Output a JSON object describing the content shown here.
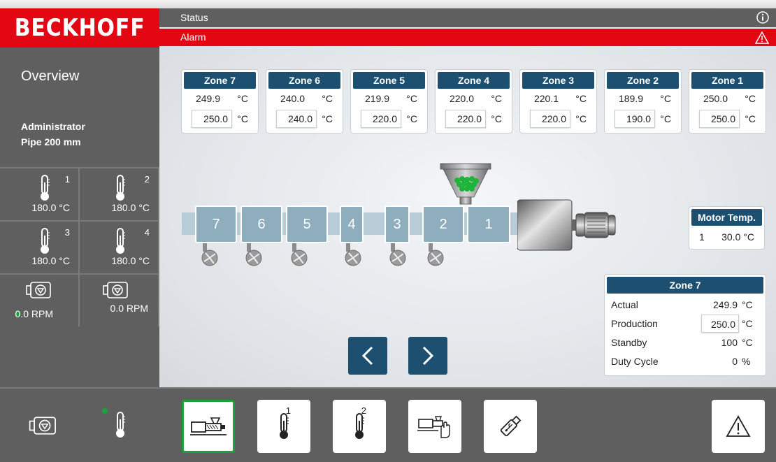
{
  "brand": "BECKHOFF",
  "status_label": "Status",
  "alarm_label": "Alarm",
  "page_title": "Overview",
  "user": {
    "role": "Administrator",
    "product": "Pipe 200 mm"
  },
  "sidebar_sensors": [
    {
      "id": "1",
      "value": "180.0 °C"
    },
    {
      "id": "2",
      "value": "180.0 °C"
    },
    {
      "id": "3",
      "value": "180.0 °C"
    },
    {
      "id": "4",
      "value": "180.0 °C"
    }
  ],
  "sidebar_motors": [
    {
      "value": "0.0 RPM",
      "running": true
    },
    {
      "value": "0.0 RPM",
      "running": false
    }
  ],
  "zones": [
    {
      "title": "Zone 7",
      "actual": "249.9",
      "setpoint": "250.0",
      "unit": "°C"
    },
    {
      "title": "Zone 6",
      "actual": "240.0",
      "setpoint": "240.0",
      "unit": "°C"
    },
    {
      "title": "Zone 5",
      "actual": "219.9",
      "setpoint": "220.0",
      "unit": "°C"
    },
    {
      "title": "Zone 4",
      "actual": "220.0",
      "setpoint": "220.0",
      "unit": "°C"
    },
    {
      "title": "Zone 3",
      "actual": "220.1",
      "setpoint": "220.0",
      "unit": "°C"
    },
    {
      "title": "Zone 2",
      "actual": "189.9",
      "setpoint": "190.0",
      "unit": "°C"
    },
    {
      "title": "Zone 1",
      "actual": "250.0",
      "setpoint": "250.0",
      "unit": "°C"
    }
  ],
  "barrel_segments": [
    "7",
    "6",
    "5",
    "4",
    "3",
    "2",
    "1"
  ],
  "motor_temp": {
    "title": "Motor Temp.",
    "index": "1",
    "value": "30.0 °C"
  },
  "zone_detail": {
    "title": "Zone 7",
    "rows": [
      {
        "label": "Actual",
        "value": "249.9",
        "unit": "°C"
      },
      {
        "label": "Production",
        "value": "250.0",
        "unit": "°C"
      },
      {
        "label": "Standby",
        "value": "100",
        "unit": "°C"
      },
      {
        "label": "Duty Cycle",
        "value": "0",
        "unit": "%"
      }
    ]
  },
  "toolbar": {
    "thermo1_sup": "1",
    "thermo2_sup": "2"
  },
  "colors": {
    "brand_red": "#e30613",
    "header_blue": "#1d5070",
    "panel_gray": "#5f5f5f",
    "status_green": "#1ea13c",
    "segment_blue": "#8eaebd"
  },
  "icons": [
    "info-icon",
    "warning-icon",
    "thermometer-icon",
    "motor-icon",
    "extruder-icon",
    "machine-hand-icon",
    "usb-icon",
    "chevron-left-icon",
    "chevron-right-icon"
  ]
}
